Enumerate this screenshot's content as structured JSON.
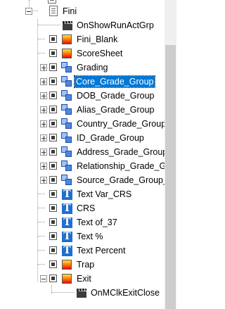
{
  "tree": {
    "items": [
      {
        "label": "",
        "icon": "page-icon",
        "partial": true
      },
      {
        "label": "Fini",
        "icon": "page-icon"
      },
      {
        "label": "OnShowRunActGrp",
        "icon": "clapperboard-icon"
      },
      {
        "label": "Fini_Blank",
        "icon": "flame-icon"
      },
      {
        "label": "ScoreSheet",
        "icon": "flame-icon"
      },
      {
        "label": "Grading",
        "icon": "grade-icon"
      },
      {
        "label": "Core_Grade_Group",
        "icon": "grade-icon",
        "selected": true
      },
      {
        "label": "DOB_Grade_Group",
        "icon": "grade-icon"
      },
      {
        "label": "Alias_Grade_Group",
        "icon": "grade-icon"
      },
      {
        "label": "Country_Grade_Group",
        "icon": "grade-icon"
      },
      {
        "label": "ID_Grade_Group",
        "icon": "grade-icon"
      },
      {
        "label": "Address_Grade_Group",
        "icon": "grade-icon"
      },
      {
        "label": "Relationship_Grade_G",
        "icon": "grade-icon"
      },
      {
        "label": "Source_Grade_Group_",
        "icon": "grade-icon"
      },
      {
        "label": "Text Var_CRS",
        "icon": "text-T-icon"
      },
      {
        "label": "CRS",
        "icon": "text-T-icon"
      },
      {
        "label": "Text of_37",
        "icon": "text-T-icon"
      },
      {
        "label": "Text %",
        "icon": "text-T-icon"
      },
      {
        "label": "Text Percent",
        "icon": "text-T-icon"
      },
      {
        "label": "Trap",
        "icon": "flame-icon"
      },
      {
        "label": "Exit",
        "icon": "flame-icon"
      },
      {
        "label": "OnMClkExitClose",
        "icon": "clapperboard-icon"
      }
    ]
  },
  "colors": {
    "selection": "#0078d7",
    "text_icon_blue": "#1f6fd0"
  }
}
